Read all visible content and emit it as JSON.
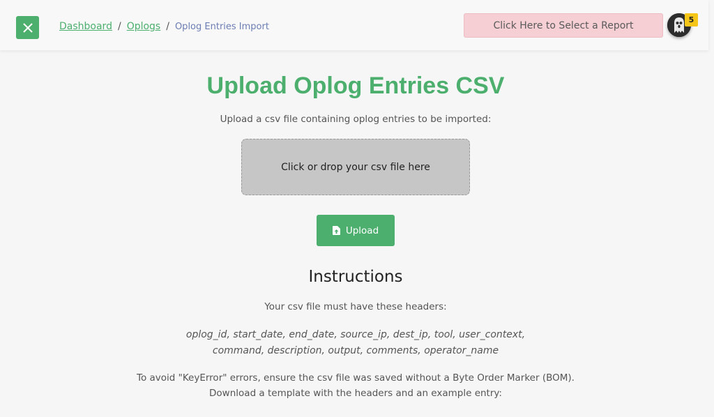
{
  "header": {
    "breadcrumb": {
      "dashboard": "Dashboard",
      "oplogs": "Oplogs",
      "separator": "/",
      "current": "Oplog Entries Import"
    },
    "report_button_label": "Click Here to Select a Report",
    "notification_count": "5",
    "icons": {
      "close": "close-icon",
      "avatar": "ghost-avatar-icon"
    }
  },
  "main": {
    "title": "Upload Oplog Entries CSV",
    "subtitle": "Upload a csv file containing oplog entries to be imported:",
    "dropzone_label": "Click or drop your csv file here",
    "upload_button_label": "Upload",
    "upload_icon": "file-upload-icon",
    "instructions": {
      "title": "Instructions",
      "headers_intro": "Your csv file must have these headers:",
      "headers_line1": "oplog_id, start_date, end_date, source_ip, dest_ip, tool, user_context,",
      "headers_line2": "command, description, output, comments, operator_name",
      "bom_note": "To avoid \"KeyError\" errors, ensure the csv file was saved without a Byte Order Marker (BOM).",
      "template_note": "Download a template with the headers and an example entry:"
    }
  },
  "colors": {
    "accent": "#4caf6e",
    "report_button_bg": "#f5cfd4",
    "badge": "#f5c518",
    "breadcrumb_current": "#6b7db3",
    "dropzone_bg": "#c6c6c6",
    "page_bg": "#f6f6f6"
  }
}
